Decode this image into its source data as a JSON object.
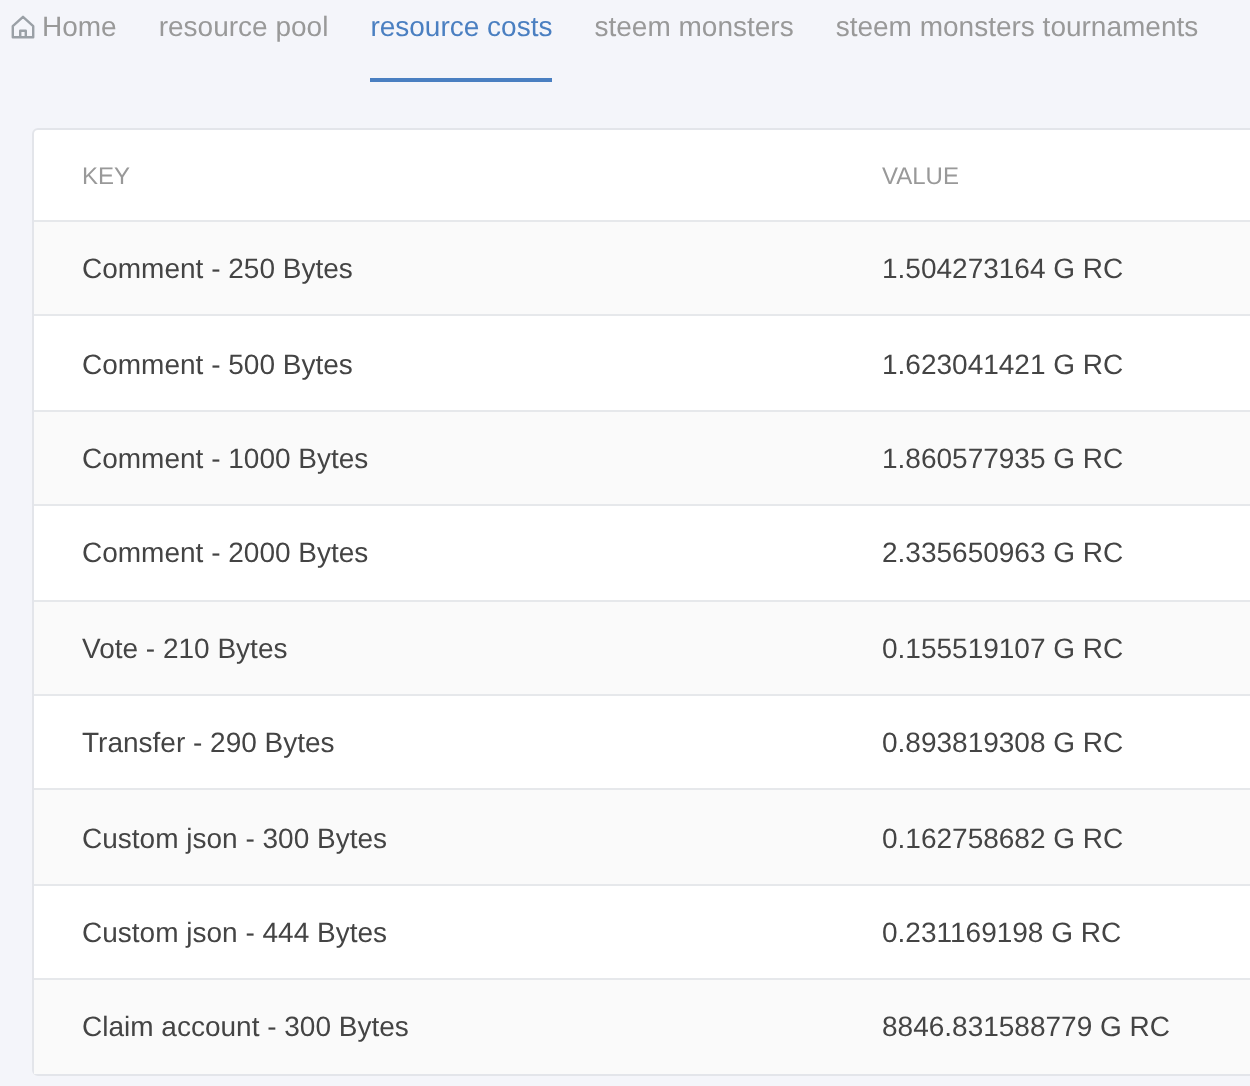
{
  "tabs": [
    {
      "label": "Home",
      "kind": "home",
      "selected": false
    },
    {
      "label": "resource pool",
      "kind": "plain",
      "selected": false
    },
    {
      "label": "resource costs",
      "kind": "plain",
      "selected": true
    },
    {
      "label": "steem monsters",
      "kind": "plain",
      "selected": false
    },
    {
      "label": "steem monsters tournaments",
      "kind": "plain",
      "selected": false
    }
  ],
  "table": {
    "columns": [
      "KEY",
      "VALUE"
    ],
    "rows": [
      [
        "Comment - 250 Bytes",
        "1.504273164 G RC"
      ],
      [
        "Comment - 500 Bytes",
        "1.623041421 G RC"
      ],
      [
        "Comment - 1000 Bytes",
        "1.860577935 G RC"
      ],
      [
        "Comment - 2000 Bytes",
        "2.335650963 G RC"
      ],
      [
        "Vote - 210 Bytes",
        "0.155519107 G RC"
      ],
      [
        "Transfer - 290 Bytes",
        "0.893819308 G RC"
      ],
      [
        "Custom json - 300 Bytes",
        "0.162758682 G RC"
      ],
      [
        "Custom json - 444 Bytes",
        "0.231169198 G RC"
      ],
      [
        "Claim account - 300 Bytes",
        "8846.831588779 G RC"
      ]
    ]
  }
}
